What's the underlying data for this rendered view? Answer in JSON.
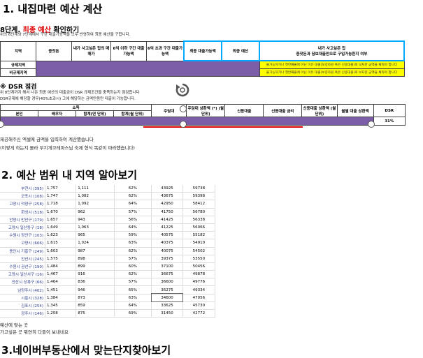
{
  "title": "1. 내집마련 예산 계산",
  "step8": {
    "prefix": "8단계. ",
    "highlight": "최종 예산",
    "suffix": " 확인하기"
  },
  "step8_desc": "위의 6단계와 7단계에서 구한 대출가능액을 모두 반영하여 최종 예산을 구합니다.",
  "table1": {
    "headers": [
      "지역",
      "종잣돈",
      "내가 사고싶은 집의 매매가",
      "6억 이하 구간 대출가능액",
      "6억 초과 구간 대출가능액",
      "최종 대출가능액",
      "최종 예산"
    ],
    "note_header": "내가 사고싶은 집\n종잣돈과 담보대출만으로 구입가능한지 여부",
    "rows": [
      {
        "label": "규제지역",
        "note": "불가능하거나 첫번째줄에 아닌 이유 대출(보증자원 혹은 신용대출)로 보자란 금액을 채워야 합니다"
      },
      {
        "label": "비규제지역",
        "note": "불가능하거나 첫번째줄에 아닌 이유 대출(보증자원 혹은 신용대출)로 보자란 금액을 채워야 합니다"
      }
    ]
  },
  "dsr": {
    "heading": "※ DSR 점검",
    "line1": "위 8단계까지 해서 나온 최종 예산의 대출금이 DSR 규제조건을 충족하는지 점검합니다",
    "line2": "DSR규제에 해당할 경우(40%초과시) 그에 해당하는 금액만큼만 대출이 가능합니다.",
    "income_header": "소득",
    "headers": [
      "본인",
      "배우자",
      "합계(연 단위)",
      "합계(월 단위)",
      "주담대",
      "주담대 상환액 (*) (월 단위)",
      "신용대출",
      "신용대출 금리",
      "신용대출 상환액 (월 단위)",
      "월별 대출 상환액",
      "DSR"
    ],
    "dsr_value": "31%"
  },
  "instructions": {
    "line1": "제공해주신 엑셀에 금액을 입력하여 계산했습니다",
    "line2": "(이렇게 하는지 몰라 무지개코레파스님 숙제 형식 똑같이 따라했습니다)"
  },
  "section2_title": "2. 예산 범위 내 지역 알아보기",
  "region_table": [
    [
      "부천시 (395)",
      "1,757",
      "1,111",
      "62%",
      "43925",
      "59738"
    ],
    [
      "군포시 (108)",
      "1,747",
      "1,082",
      "62%",
      "43675",
      "59398"
    ],
    [
      "고양시 덕양구 (258)",
      "1,718",
      "1,092",
      "64%",
      "42950",
      "58412"
    ],
    [
      "화성시 (518)",
      "1,670",
      "962",
      "57%",
      "41750",
      "56780"
    ],
    [
      "안양시 만안구 (179)",
      "1,657",
      "943",
      "56%",
      "41425",
      "56338"
    ],
    [
      "고양시 일산동구 (18)",
      "1,649",
      "1,063",
      "64%",
      "41225",
      "56066"
    ],
    [
      "수원시 장안구 (103)",
      "1,623",
      "965",
      "59%",
      "40575",
      "55182"
    ],
    [
      "고양시 (606)",
      "1,615",
      "1,024",
      "63%",
      "40375",
      "54910"
    ],
    [
      "용인시 기흥구 (249)",
      "1,603",
      "987",
      "62%",
      "40075",
      "54502"
    ],
    [
      "안산시 (245)",
      "1,575",
      "898",
      "57%",
      "39375",
      "53550"
    ],
    [
      "수원시 권선구 (190)",
      "1,484",
      "899",
      "60%",
      "37100",
      "50456"
    ],
    [
      "고양시 일산서구 (16)",
      "1,467",
      "916",
      "62%",
      "36675",
      "49878"
    ],
    [
      "안산시 상록구 (66)",
      "1,464",
      "836",
      "57%",
      "36600",
      "49776"
    ],
    [
      "남양주시 (402)",
      "1,451",
      "946",
      "65%",
      "36275",
      "49334"
    ],
    [
      "시흥시 (328)",
      "1,384",
      "873",
      "63%",
      "34600",
      "47056"
    ],
    [
      "김포시 (254)",
      "1,345",
      "859",
      "64%",
      "33625",
      "45730"
    ],
    [
      "광주시 (146)",
      "1,258",
      "875",
      "69%",
      "31450",
      "42772"
    ]
  ],
  "after_table": {
    "line1": "예산에 맞는 곳",
    "line2": "가고싶은 곳  뭐연히 다들이 보내네요"
  },
  "section3_title": "3.네이버부동산에서 맞는단지찾아보기",
  "colors": {
    "purple": "#7b5ea7",
    "yellow": "#ffff00",
    "blue": "#00aaff",
    "red": "#e00000"
  }
}
